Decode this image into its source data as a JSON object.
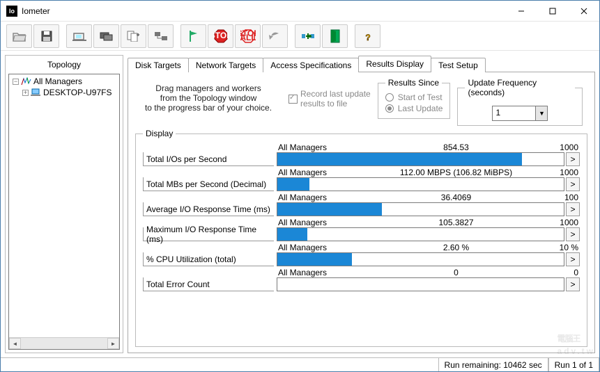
{
  "window": {
    "title": "Iometer"
  },
  "toolbar_icons": [
    "open-icon",
    "save-icon",
    "network-icon",
    "network2-icon",
    "duplicate-icon",
    "paste-icon",
    "flag-start-icon",
    "stop-icon",
    "stop-all-icon",
    "undo-icon",
    "distribute-icon",
    "exit-icon",
    "help-icon"
  ],
  "topology": {
    "title": "Topology",
    "root": "All Managers",
    "node": "DESKTOP-U97FS"
  },
  "tabs": [
    {
      "label": "Disk Targets"
    },
    {
      "label": "Network Targets"
    },
    {
      "label": "Access Specifications"
    },
    {
      "label": "Results Display",
      "active": true
    },
    {
      "label": "Test Setup"
    }
  ],
  "hint": {
    "line1": "Drag managers and workers",
    "line2": "from the Topology window",
    "line3": "to the progress bar of your choice."
  },
  "record": {
    "label": "Record last update",
    "label2": "results to file",
    "checked": true
  },
  "results_since": {
    "legend": "Results Since",
    "opt1": "Start of Test",
    "opt2": "Last Update",
    "selected": "Last Update"
  },
  "update_freq": {
    "legend": "Update Frequency (seconds)",
    "value": "1"
  },
  "display_legend": "Display",
  "metrics": [
    {
      "label": "Total I/Os per Second",
      "source": "All Managers",
      "value": "854.53",
      "max": "1000",
      "pct": 85.5
    },
    {
      "label": "Total MBs per Second (Decimal)",
      "source": "All Managers",
      "value": "112.00 MBPS (106.82 MiBPS)",
      "max": "1000",
      "pct": 11.2
    },
    {
      "label": "Average I/O Response Time (ms)",
      "source": "All Managers",
      "value": "36.4069",
      "max": "100",
      "pct": 36.4
    },
    {
      "label": "Maximum I/O Response Time (ms)",
      "source": "All Managers",
      "value": "105.3827",
      "max": "1000",
      "pct": 10.5
    },
    {
      "label": "% CPU Utilization (total)",
      "source": "All Managers",
      "value": "2.60 %",
      "max": "10 %",
      "pct": 26
    },
    {
      "label": "Total Error Count",
      "source": "All Managers",
      "value": "0",
      "max": "0",
      "pct": 0
    }
  ],
  "chart_data": {
    "type": "bar",
    "title": "Results Display",
    "series": [
      {
        "name": "Total I/Os per Second",
        "value": 854.53,
        "max": 1000
      },
      {
        "name": "Total MBs per Second (Decimal)",
        "value": 112.0,
        "max": 1000
      },
      {
        "name": "Average I/O Response Time (ms)",
        "value": 36.4069,
        "max": 100
      },
      {
        "name": "Maximum I/O Response Time (ms)",
        "value": 105.3827,
        "max": 1000
      },
      {
        "name": "% CPU Utilization (total)",
        "value": 2.6,
        "max": 10
      },
      {
        "name": "Total Error Count",
        "value": 0,
        "max": 0
      }
    ]
  },
  "status": {
    "remaining": "Run remaining: 10462 sec",
    "run": "Run 1 of 1"
  },
  "watermark": {
    "big": "電腦王",
    "small": "adv.tw"
  }
}
